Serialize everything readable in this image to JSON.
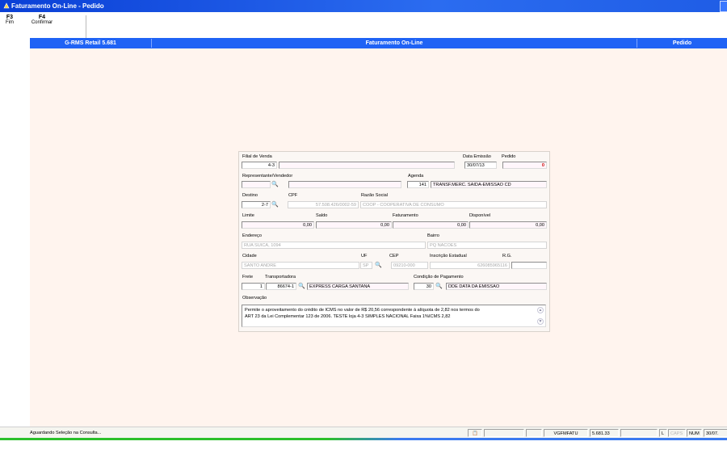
{
  "window": {
    "title": "Faturamento On-Line - Pedido"
  },
  "toolbar": {
    "f3_key": "F3",
    "f3_label": "Fim",
    "f4_key": "F4",
    "f4_label": "Confirmar"
  },
  "header": {
    "left": "G-RMS Retail 5.681",
    "center": "Faturamento On-Line",
    "right": "Pedido"
  },
  "form": {
    "filial_label": "Filial de Venda",
    "filial_code": "4-3",
    "filial_name": "",
    "data_emissao_label": "Data Emissão",
    "data_emissao": "30/07/13",
    "pedido_label": "Pedido",
    "pedido": "0",
    "representante_label": "Representante/Vendedor",
    "representante_code": "",
    "representante_name": "",
    "agenda_label": "Agenda",
    "agenda_code": "141",
    "agenda_desc": "TRANSF.MERC. SAIDA-EMISSAO CD",
    "destino_label": "Destino",
    "destino_code": "2-7",
    "cpf_label": "CPF",
    "cpf": "57.508.426/0002-59",
    "razao_label": "Razão Social",
    "razao": "COOP - COOPERATIVA DE CONSUMO",
    "limite_label": "Limite",
    "limite": "0,00",
    "saldo_label": "Saldo",
    "saldo": "0,00",
    "faturamento_label": "Faturamento",
    "faturamento": "0,00",
    "disponivel_label": "Disponível",
    "disponivel": "0,00",
    "endereco_label": "Endereço",
    "endereco": "RUA SUICA, 1094",
    "bairro_label": "Bairro",
    "bairro": "PQ NACOES",
    "cidade_label": "Cidade",
    "cidade": "SANTO ANDRE",
    "uf_label": "UF",
    "uf": "SP",
    "cep_label": "CEP",
    "cep": "09210-000",
    "ie_label": "Inscrição Estadual",
    "ie": "626085965116",
    "rg_label": "R.G.",
    "rg": "",
    "frete_label": "Frete",
    "frete": "1",
    "transportadora_label": "Transportadora",
    "transportadora_code": "86674-1",
    "transportadora_name": "EXPRESS CARGA SANTANA",
    "cond_label": "Condição de Pagamento",
    "cond_code": "30",
    "cond_desc": "DDE  DATA DA EMISSAO",
    "obs_label": "Observação",
    "obs_line1": "Permite o aproveitamento do crédito de ICMS no valor de R$ 20,56 correspondente à alíquota de 2,82 nos termos do",
    "obs_line2": "ART 23 da Lei Complementar 123 de 2006. TESTE loja 4-3 SIMPLES NACIONAL Faixa 1%ICMS 2,82"
  },
  "statusbar": {
    "message": "Aguardando Seleção na Consulta...",
    "program": "VGFMFATU",
    "version": "5.681.33",
    "l": "L",
    "caps": "CAPS",
    "num": "NUM",
    "date": "30/07."
  },
  "icons": {
    "window": "app-icon",
    "lookup": "binoculars-icon",
    "status": "clipboard-icon",
    "scroll_up": "scroll-up-icon",
    "scroll_down": "scroll-down-icon"
  }
}
